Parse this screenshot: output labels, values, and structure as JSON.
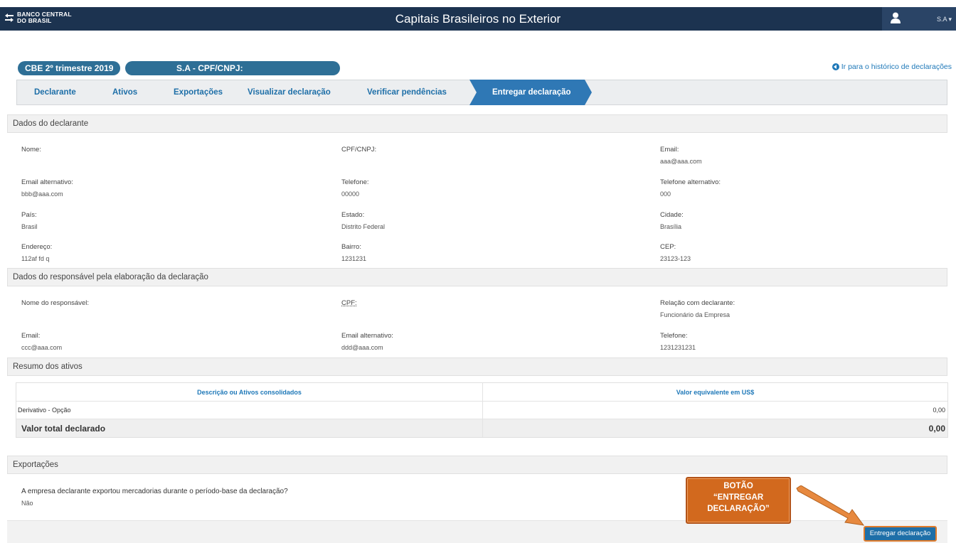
{
  "header": {
    "logo_line1": "BANCO CENTRAL",
    "logo_line2": "DO BRASIL",
    "title": "Capitais Brasileiros no Exterior",
    "user": "S.A"
  },
  "context": {
    "period": "CBE 2º trimestre 2019",
    "declarant": "S.A - CPF/CNPJ:",
    "history_link": "Ir para o histórico de declarações"
  },
  "steps": [
    {
      "label": "Declarante"
    },
    {
      "label": "Ativos"
    },
    {
      "label": "Exportações"
    },
    {
      "label": "Visualizar declaração"
    },
    {
      "label": "Verificar pendências"
    },
    {
      "label": "Entregar declaração",
      "active": true
    }
  ],
  "declarante": {
    "section_title": "Dados do declarante",
    "nome_label": "Nome:",
    "nome_value": "",
    "cpf_label": "CPF/CNPJ:",
    "cpf_value": "",
    "email_label": "Email:",
    "email_value": "aaa@aaa.com",
    "email_alt_label": "Email alternativo:",
    "email_alt_value": "bbb@aaa.com",
    "telefone_label": "Telefone:",
    "telefone_value": "00000",
    "telefone_alt_label": "Telefone alternativo:",
    "telefone_alt_value": "000",
    "pais_label": "País:",
    "pais_value": "Brasil",
    "estado_label": "Estado:",
    "estado_value": "Distrito Federal",
    "cidade_label": "Cidade:",
    "cidade_value": "Brasília",
    "endereco_label": "Endereço:",
    "endereco_value": "112af fd q",
    "bairro_label": "Bairro:",
    "bairro_value": "1231231",
    "cep_label": "CEP:",
    "cep_value": "23123-123"
  },
  "responsavel": {
    "section_title": "Dados do responsável pela elaboração da declaração",
    "nome_label": "Nome do responsável:",
    "cpf_label": "CPF:",
    "relacao_label": "Relação com declarante:",
    "relacao_value": "Funcionário da Empresa",
    "email_label": "Email:",
    "email_value": "ccc@aaa.com",
    "email_alt_label": "Email alternativo:",
    "email_alt_value": "ddd@aaa.com",
    "telefone_label": "Telefone:",
    "telefone_value": "1231231231"
  },
  "resumo": {
    "section_title": "Resumo dos ativos",
    "col_desc": "Descrição ou Ativos consolidados",
    "col_valor": "Valor equivalente em US$",
    "rows": [
      {
        "desc": "Derivativo - Opção",
        "valor": "0,00"
      }
    ],
    "total_label": "Valor total declarado",
    "total_value": "0,00"
  },
  "exportacoes": {
    "section_title": "Exportações",
    "question": "A empresa declarante exportou mercadorias durante o período-base da declaração?",
    "answer": "Não"
  },
  "actions": {
    "deliver_label": "Entregar declaração"
  },
  "callout": {
    "line1": "BOTÃO",
    "line2": "“ENTREGAR",
    "line3": "DECLARAÇÃO”"
  },
  "colors": {
    "header_bg": "#1c3350",
    "accent_blue": "#2e6f96",
    "link_blue": "#1e78b8",
    "active_step": "#2f78b5",
    "callout_orange": "#d2691e"
  }
}
